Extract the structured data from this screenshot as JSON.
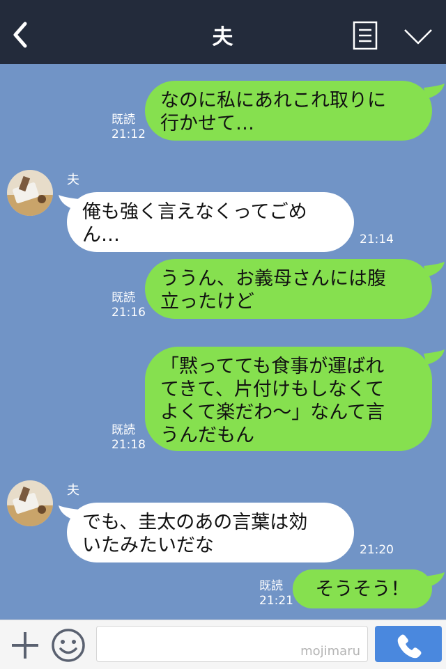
{
  "header": {
    "title": "夫"
  },
  "messages": [
    {
      "side": "me",
      "text": "なのに私にあれこれ取りに\n行かせて…",
      "read": "既読",
      "time": "21:12"
    },
    {
      "side": "them",
      "sender": "夫",
      "text": "俺も強く言えなくってごめ\nん…",
      "time": "21:14"
    },
    {
      "side": "me",
      "text": "ううん、お義母さんには腹\n立ったけど",
      "read": "既読",
      "time": "21:16"
    },
    {
      "side": "me",
      "text": "「黙ってても食事が運ばれ\nてきて、片付けもしなくて\nよくて楽だわ〜」なんて言\nうんだもん",
      "read": "既読",
      "time": "21:18"
    },
    {
      "side": "them",
      "sender": "夫",
      "text": "でも、圭太のあの言葉は効\nいたみたいだな",
      "time": "21:20"
    },
    {
      "side": "me",
      "text": "そうそう！",
      "read": "既読",
      "time": "21:21"
    }
  ],
  "input": {
    "placeholder": "",
    "watermark": "mojimaru"
  },
  "colors": {
    "header": "#232b3b",
    "background": "#7194c6",
    "my_bubble": "#86e04f",
    "their_bubble": "#ffffff",
    "call_button": "#4a88de"
  },
  "icons": [
    "back-arrow-icon",
    "menu-list-icon",
    "chevron-down-icon",
    "plus-icon",
    "emoji-smile-icon",
    "phone-icon"
  ]
}
